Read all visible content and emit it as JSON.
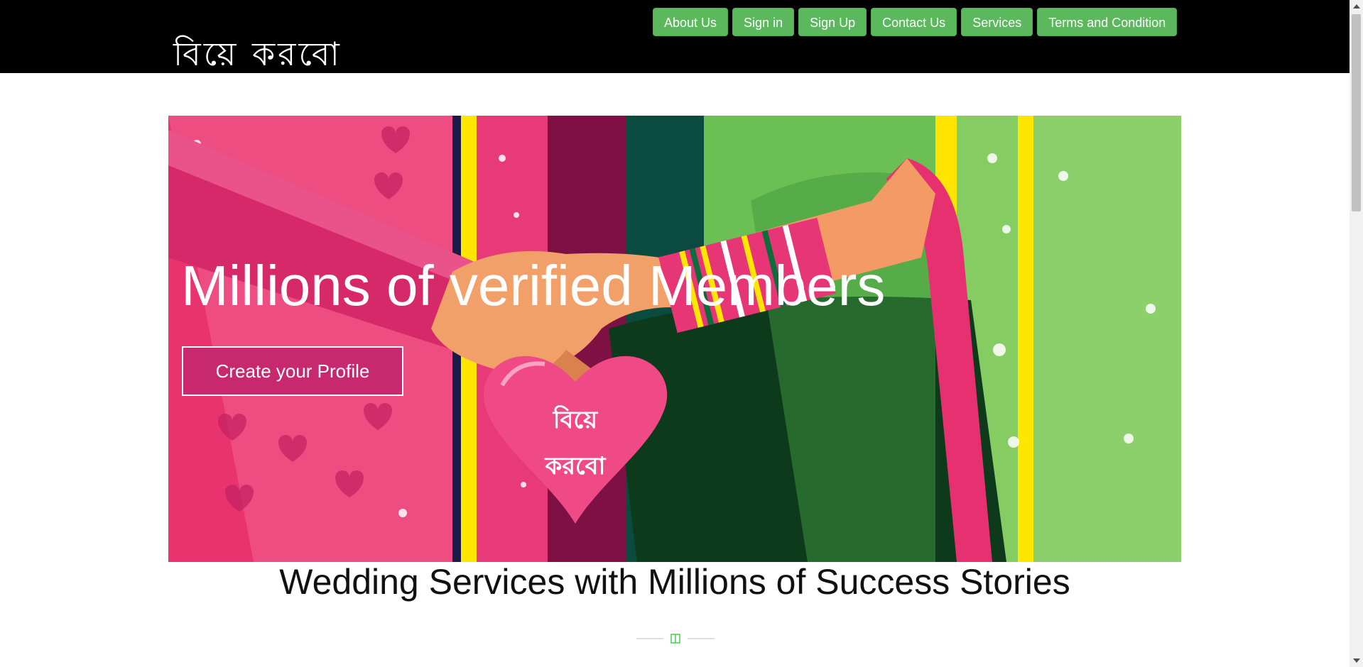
{
  "header": {
    "logo_text": "বিয়ে করবো",
    "nav": [
      "About Us",
      "Sign in",
      "Sign Up",
      "Contact Us",
      "Services",
      "Terms and Condition"
    ]
  },
  "hero": {
    "title": "Millions of verified Members",
    "cta_label": "Create your Profile",
    "heart_line1": "বিয়ে",
    "heart_line2": "করবো"
  },
  "section": {
    "title": "Wedding Services with Millions of Success Stories"
  },
  "colors": {
    "nav_button": "#5cb85c",
    "cta_button": "#c8286e",
    "header_bg": "#000000"
  }
}
